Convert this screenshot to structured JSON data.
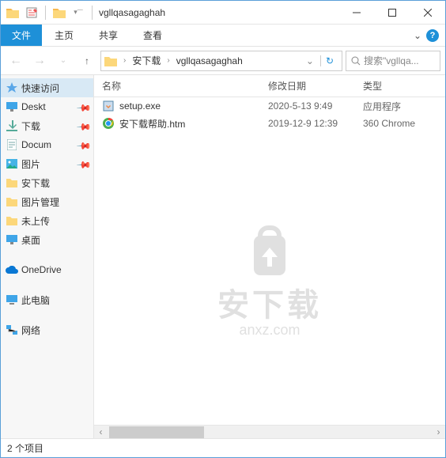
{
  "window": {
    "title": "vgllqasagaghah"
  },
  "ribbon": {
    "file": "文件",
    "home": "主页",
    "share": "共享",
    "view": "查看"
  },
  "breadcrumb": {
    "items": [
      "安下载",
      "vgllqasagaghah"
    ]
  },
  "search": {
    "placeholder": "搜索\"vgllqa..."
  },
  "columns": {
    "name": "名称",
    "date": "修改日期",
    "type": "类型"
  },
  "files": [
    {
      "icon": "installer",
      "name": "setup.exe",
      "date": "2020-5-13 9:49",
      "type": "应用程序"
    },
    {
      "icon": "chrome",
      "name": "安下载帮助.htm",
      "date": "2019-12-9 12:39",
      "type": "360 Chrome"
    }
  ],
  "sidebar": {
    "quick": "快速访问",
    "items": [
      {
        "label": "Deskt",
        "icon": "desktop",
        "pinned": true
      },
      {
        "label": "下载",
        "icon": "download",
        "pinned": true
      },
      {
        "label": "Docum",
        "icon": "document",
        "pinned": true
      },
      {
        "label": "图片",
        "icon": "pictures",
        "pinned": true
      },
      {
        "label": "安下载",
        "icon": "folder"
      },
      {
        "label": "图片管理",
        "icon": "folder"
      },
      {
        "label": "未上传",
        "icon": "folder"
      },
      {
        "label": "桌面",
        "icon": "desktop2"
      }
    ],
    "onedrive": "OneDrive",
    "thispc": "此电脑",
    "network": "网络"
  },
  "watermark": {
    "text": "安下载",
    "url": "anxz.com"
  },
  "status": "2 个项目"
}
